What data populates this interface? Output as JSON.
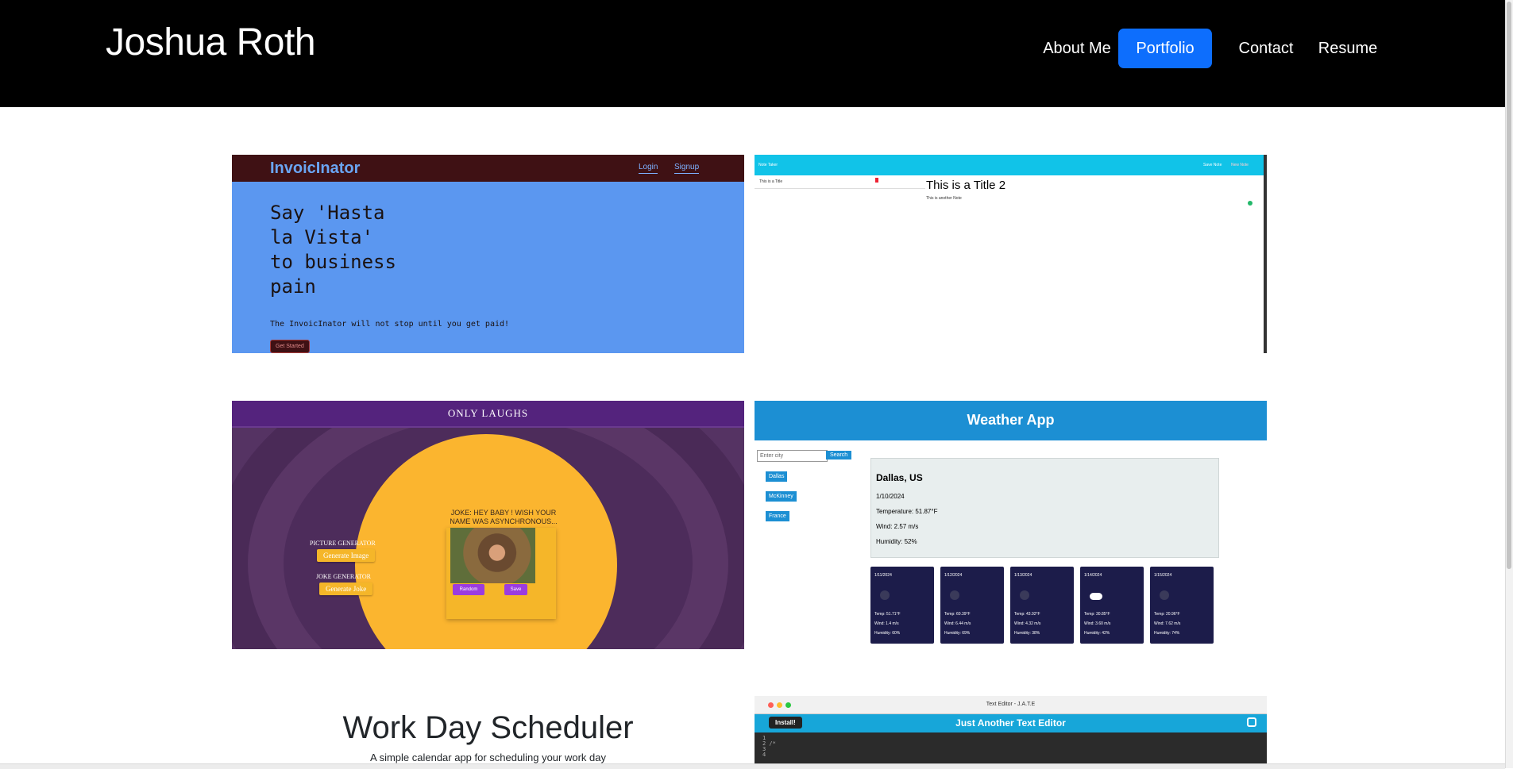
{
  "header": {
    "brand": "Joshua Roth",
    "nav": [
      "About Me",
      "Portfolio",
      "Contact",
      "Resume"
    ],
    "active": "Portfolio",
    "accent": "#0d6efd"
  },
  "invoicinator": {
    "logo": "InvoicInator",
    "login": "Login",
    "signup": "Signup",
    "headline": "Say 'Hasta\nla Vista'\nto business\npain",
    "subline": "The InvoicInator will not stop until you get paid!",
    "button": "Get Started"
  },
  "note_taker": {
    "app": "Note Taker",
    "save": "Save Note",
    "new": "New Note",
    "list_item": "This is a Title",
    "title": "This is a Title 2",
    "text": "This is another Note"
  },
  "only_laughs": {
    "title": "ONLY LAUGHS",
    "picture_label": "PICTURE GENERATOR",
    "picture_button": "Generate Image",
    "joke_label": "JOKE GENERATOR",
    "joke_button": "Generate Joke",
    "joke": "JOKE: HEY BABY ! WISH YOUR NAME WAS ASYNCHRONOUS...",
    "random": "Random",
    "save": "Save"
  },
  "weather": {
    "title": "Weather App",
    "placeholder": "Enter city",
    "search": "Search",
    "cities": [
      "Dallas",
      "McKinney",
      "France"
    ],
    "current": {
      "city": "Dallas, US",
      "date": "1/10/2024",
      "temp": "Temperature: 51.87°F",
      "wind": "Wind: 2.57 m/s",
      "humidity": "Humidity: 52%"
    },
    "forecast": [
      {
        "date": "1/11/2024",
        "temp": "Temp: 51.71°F",
        "wind": "Wind: 1.4 m/s",
        "humidity": "Humidity: 60%"
      },
      {
        "date": "1/12/2024",
        "temp": "Temp: 60.39°F",
        "wind": "Wind: 6.44 m/s",
        "humidity": "Humidity: 69%"
      },
      {
        "date": "1/13/2024",
        "temp": "Temp: 43.92°F",
        "wind": "Wind: 4.32 m/s",
        "humidity": "Humidity: 38%"
      },
      {
        "date": "1/14/2024",
        "temp": "Temp: 30.85°F",
        "wind": "Wind: 3.60 m/s",
        "humidity": "Humidity: 42%"
      },
      {
        "date": "1/15/2024",
        "temp": "Temp: 20.96°F",
        "wind": "Wind: 7.62 m/s",
        "humidity": "Humidity: 74%"
      }
    ]
  },
  "scheduler": {
    "title": "Work Day Scheduler",
    "subtitle": "A simple calendar app for scheduling your work day"
  },
  "jate": {
    "window_title": "Text Editor - J.A.T.E",
    "install": "Install!",
    "title": "Just Another Text Editor",
    "lines": [
      "1",
      "2  /*",
      "3",
      "4"
    ]
  }
}
